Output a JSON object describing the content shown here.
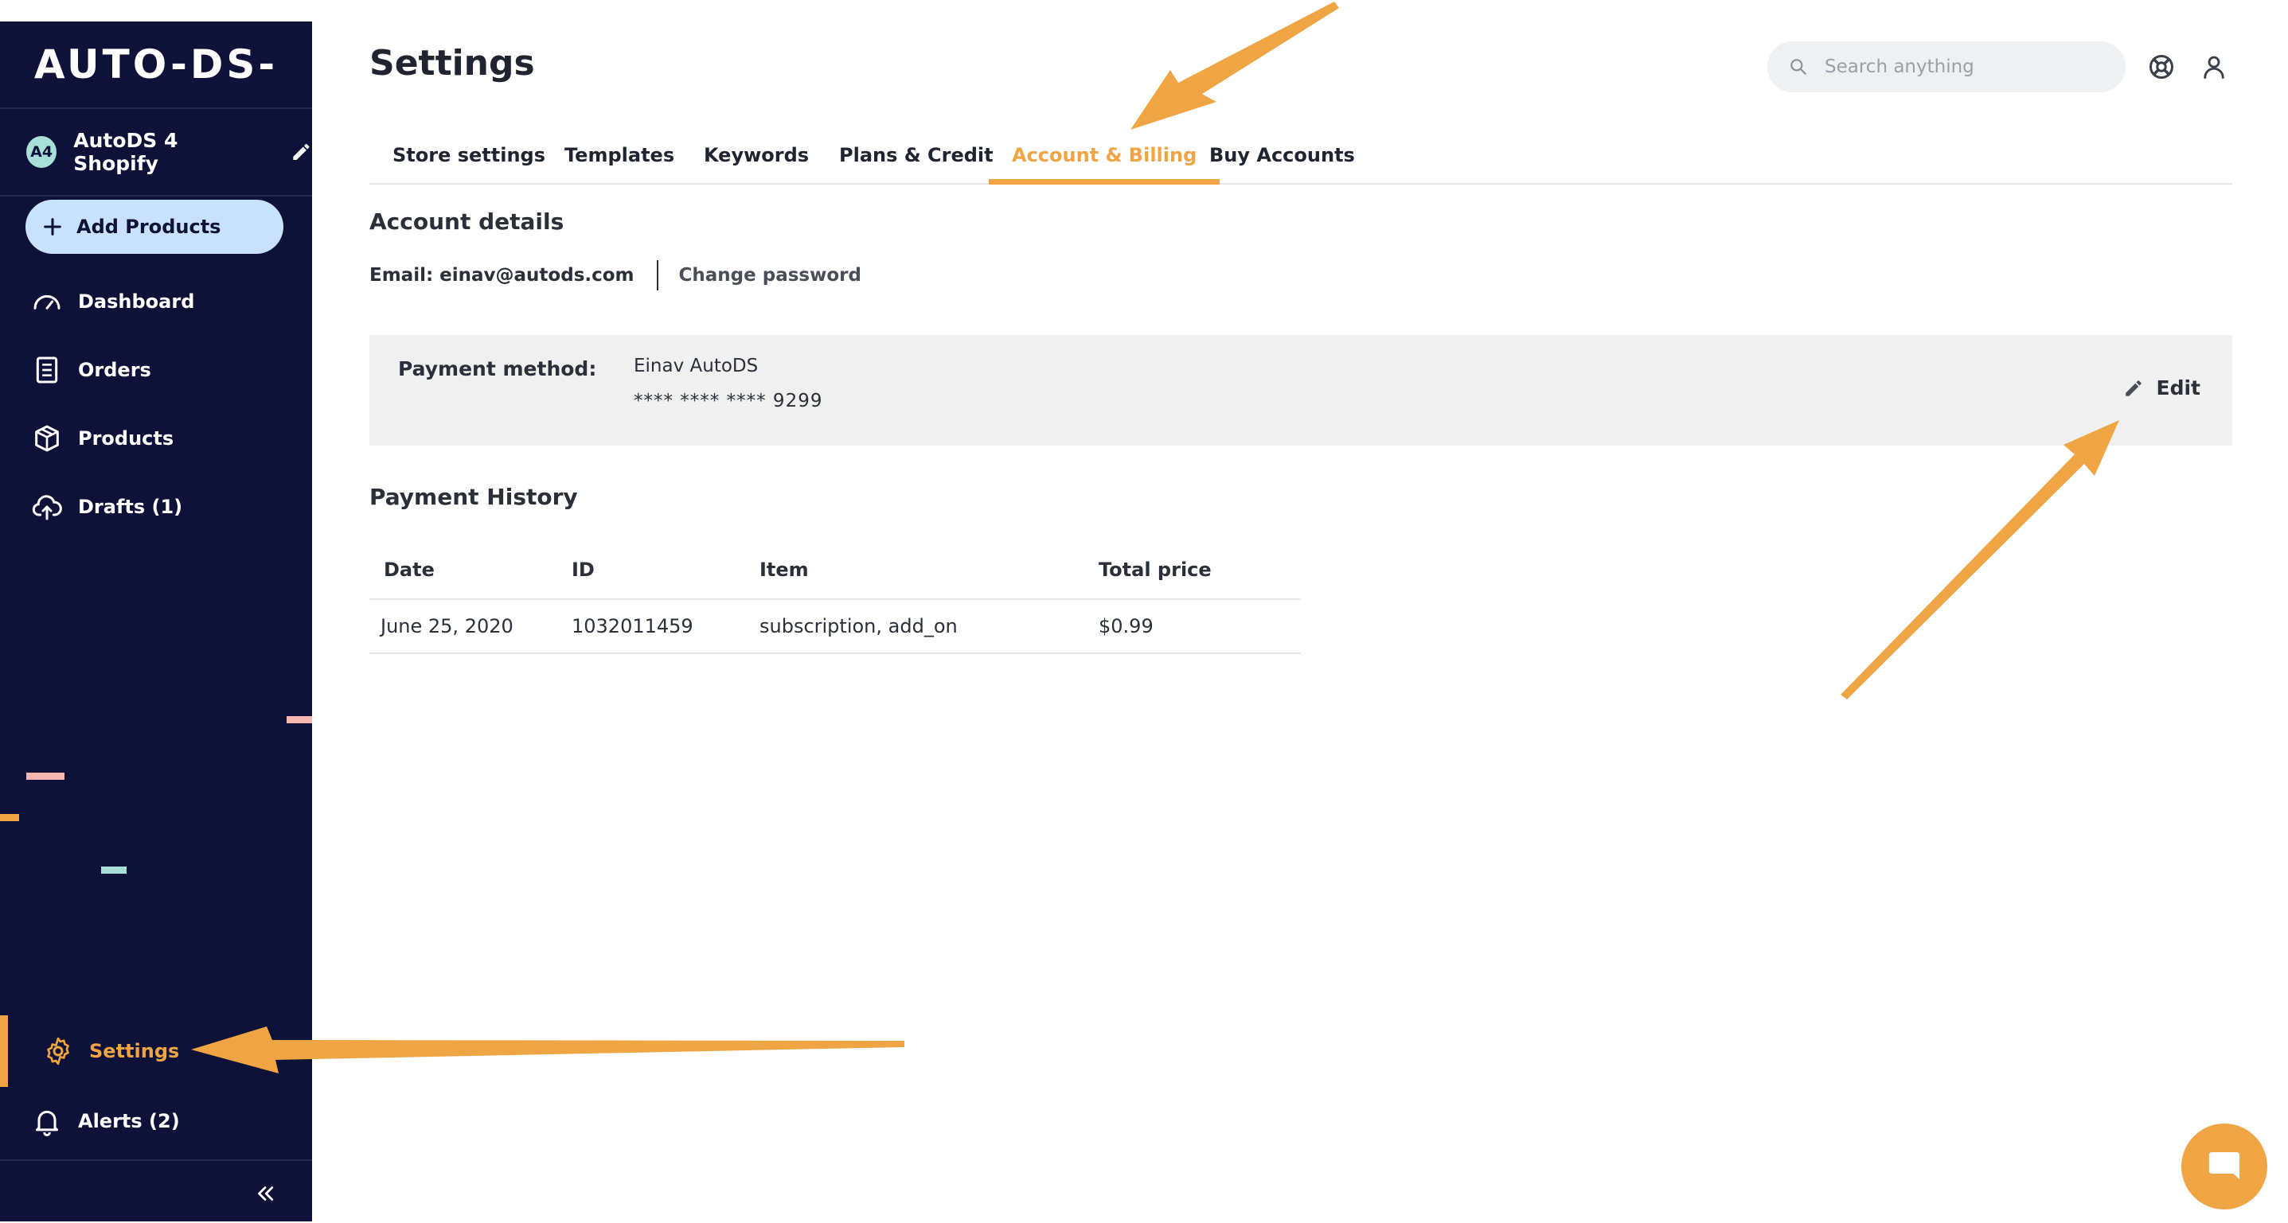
{
  "app": {
    "logo": "AUTO-DS-",
    "accent_color": "#f0a545",
    "sidebar_color": "#0e1138"
  },
  "sidebar": {
    "store": {
      "avatar": "A4",
      "name": "AutoDS 4 Shopify"
    },
    "add_products_label": "Add Products",
    "items": [
      {
        "label": "Dashboard",
        "icon": "gauge-icon"
      },
      {
        "label": "Orders",
        "icon": "document-icon"
      },
      {
        "label": "Products",
        "icon": "box-icon"
      },
      {
        "label": "Drafts (1)",
        "icon": "cloud-upload-icon"
      }
    ],
    "bottom_items": [
      {
        "label": "Settings",
        "icon": "gear-icon",
        "active": true
      },
      {
        "label": "Alerts (2)",
        "icon": "bell-icon"
      }
    ]
  },
  "header": {
    "title": "Settings",
    "search_placeholder": "Search anything"
  },
  "tabs": [
    {
      "label": "Store settings"
    },
    {
      "label": "Templates"
    },
    {
      "label": "Keywords"
    },
    {
      "label": "Plans & Credit"
    },
    {
      "label": "Account & Billing",
      "active": true
    },
    {
      "label": "Buy Accounts"
    }
  ],
  "account": {
    "section_title": "Account details",
    "email": "Email: einav@autods.com",
    "change_password": "Change password",
    "payment_label": "Payment method:",
    "payment_name": "Einav AutoDS",
    "payment_card": "**** **** **** 9299",
    "edit_label": "Edit"
  },
  "payment_history": {
    "title": "Payment History",
    "columns": [
      "Date",
      "ID",
      "Item",
      "Total price"
    ],
    "rows": [
      [
        "June 25, 2020",
        "1032011459",
        "subscription, add_on",
        "$0.99"
      ]
    ]
  }
}
